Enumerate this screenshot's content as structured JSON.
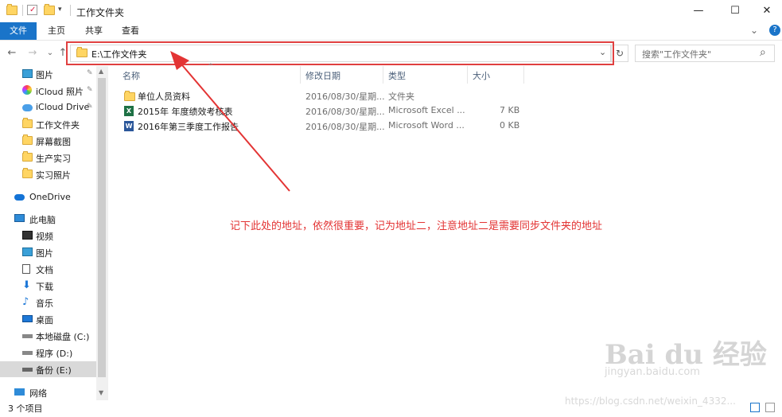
{
  "window": {
    "title": "工作文件夹",
    "minimize": "—",
    "maximize": "☐",
    "close": "✕"
  },
  "ribbon": {
    "tabs": [
      "文件",
      "主页",
      "共享",
      "查看"
    ],
    "expand": "⌄",
    "help": "?"
  },
  "nav": {
    "back": "←",
    "forward": "→",
    "recent": "⌄",
    "up": "↑",
    "address": "E:\\工作文件夹",
    "dropdown": "⌄",
    "refresh": "↻",
    "search_placeholder": "搜索\"工作文件夹\"",
    "search_icon": "⌕"
  },
  "sidebar": {
    "items": [
      {
        "label": "图片",
        "icon": "pictures-icon",
        "pinned": true
      },
      {
        "label": "iCloud 照片",
        "icon": "icloud-photos-icon",
        "pinned": true
      },
      {
        "label": "iCloud Drive",
        "icon": "icloud-drive-icon",
        "pinned": true
      },
      {
        "label": "工作文件夹",
        "icon": "folder-icon"
      },
      {
        "label": "屏幕截图",
        "icon": "folder-icon"
      },
      {
        "label": "生产实习",
        "icon": "folder-icon"
      },
      {
        "label": "实习照片",
        "icon": "folder-icon"
      },
      {
        "label": "OneDrive",
        "icon": "onedrive-icon"
      },
      {
        "label": "此电脑",
        "icon": "computer-icon"
      },
      {
        "label": "视频",
        "icon": "videos-icon"
      },
      {
        "label": "图片",
        "icon": "pictures-icon"
      },
      {
        "label": "文档",
        "icon": "documents-icon"
      },
      {
        "label": "下载",
        "icon": "downloads-icon"
      },
      {
        "label": "音乐",
        "icon": "music-icon"
      },
      {
        "label": "桌面",
        "icon": "desktop-icon"
      },
      {
        "label": "本地磁盘 (C:)",
        "icon": "drive-icon"
      },
      {
        "label": "程序 (D:)",
        "icon": "drive-icon"
      },
      {
        "label": "备份 (E:)",
        "icon": "drive-icon",
        "selected": true
      },
      {
        "label": "网络",
        "icon": "network-icon"
      }
    ],
    "pin_glyph": "📌"
  },
  "list": {
    "columns": [
      "名称",
      "修改日期",
      "类型",
      "大小"
    ],
    "sort_glyph": "^",
    "rows": [
      {
        "name": "单位人员资料",
        "date": "2016/08/30/星期...",
        "type": "文件夹",
        "size": "",
        "icon": "folder-icon"
      },
      {
        "name": "2015年 年度绩效考核表",
        "date": "2016/08/30/星期...",
        "type": "Microsoft Excel ...",
        "size": "7 KB",
        "icon": "excel-icon"
      },
      {
        "name": "2016年第三季度工作报告",
        "date": "2016/08/30/星期...",
        "type": "Microsoft Word ...",
        "size": "0 KB",
        "icon": "word-icon"
      }
    ]
  },
  "status": {
    "count": "3 个项目"
  },
  "annotation": "记下此处的地址，依然很重要，记为地址二，注意地址二是需要同步文件夹的地址",
  "watermark": {
    "logo": "Bai du 经验",
    "url": "jingyan.baidu.com",
    "csdn": "https://blog.csdn.net/weixin_4332..."
  },
  "colors": {
    "accent": "#1a74c9",
    "highlight": "#e04040",
    "selected": "#d9d9d9"
  }
}
